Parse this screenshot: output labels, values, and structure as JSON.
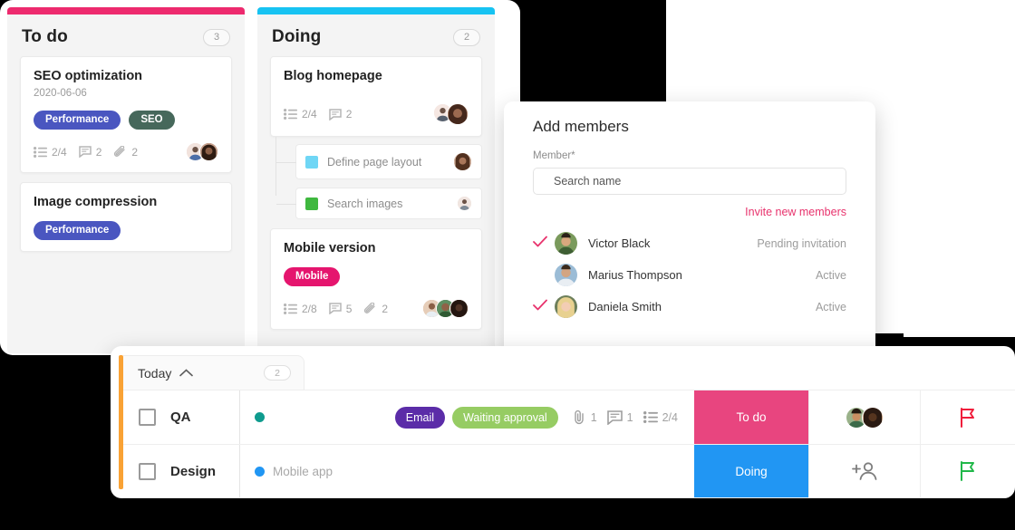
{
  "board": {
    "columns": [
      {
        "title": "To do",
        "count": "3",
        "bar_color": "#ED2A6E",
        "cards": [
          {
            "title": "SEO optimization",
            "date": "2020-06-06",
            "tags": [
              {
                "label": "Performance",
                "color": "#4A56C0"
              },
              {
                "label": "SEO",
                "color": "#46685B"
              }
            ],
            "checklist": "2/4",
            "comments": "2",
            "attachments": "2",
            "avatars": [
              "#ead9d3",
              "#6b4b3e"
            ]
          },
          {
            "title": "Image compression",
            "tags": [
              {
                "label": "Performance",
                "color": "#4A56C0"
              }
            ]
          }
        ]
      },
      {
        "title": "Doing",
        "count": "2",
        "bar_color": "#17C3F2",
        "cards": [
          {
            "title": "Blog homepage",
            "checklist": "2/4",
            "comments": "2",
            "avatars": [
              "#f0e0dc",
              "#7a5346"
            ]
          },
          {
            "title": "Mobile version",
            "tags": [
              {
                "label": "Mobile",
                "color": "#E5156E"
              }
            ],
            "checklist": "2/8",
            "comments": "5",
            "attachments": "2",
            "avatars": [
              "#d8b79b",
              "#4e7a52",
              "#3a2b24"
            ]
          }
        ],
        "subtasks": [
          {
            "label": "Define page layout",
            "color": "#6FD6F5",
            "avatar": "#8a6250"
          },
          {
            "label": "Search images",
            "color": "#3FB83F",
            "avatar": "#e8dcd6"
          }
        ]
      }
    ]
  },
  "members_dialog": {
    "title": "Add members",
    "field_label": "Member*",
    "search_placeholder": "Search name",
    "search_value": "Search name",
    "invite_link": "Invite new members",
    "accent_color": "#E8336D",
    "members": [
      {
        "name": "Victor Black",
        "status": "Pending invitation",
        "selected": true,
        "avatar": "#4f6b3f"
      },
      {
        "name": "Marius Thompson",
        "status": "Active",
        "selected": false,
        "avatar": "#3e5a6e"
      },
      {
        "name": "Daniela Smith",
        "status": "Active",
        "selected": true,
        "avatar": "#c9a86b"
      }
    ]
  },
  "task_list": {
    "group": {
      "name": "Today",
      "count": "2"
    },
    "accent_color": "#F9A235",
    "rows": [
      {
        "name": "QA",
        "project_dot": "#0F9B8E",
        "project": "",
        "tags": [
          {
            "label": "Email",
            "color": "#5B2CA8"
          },
          {
            "label": "Waiting approval",
            "color": "#96CC63"
          }
        ],
        "attachments": "1",
        "comments": "1",
        "checklist": "2/4",
        "status": "To do",
        "status_color": "#E8457F",
        "avatars": [
          "#5c7a4a",
          "#2e2019"
        ],
        "flag_color": "#F01E3C"
      },
      {
        "name": "Design",
        "project_dot": "#2196F3",
        "project": "Mobile app",
        "tags": [],
        "attachments": "",
        "comments": "",
        "checklist": "",
        "status": "Doing",
        "status_color": "#2196F3",
        "avatars": [],
        "add_assignee_icon": "add-person-icon",
        "flag_color": "#21B84A"
      }
    ]
  }
}
